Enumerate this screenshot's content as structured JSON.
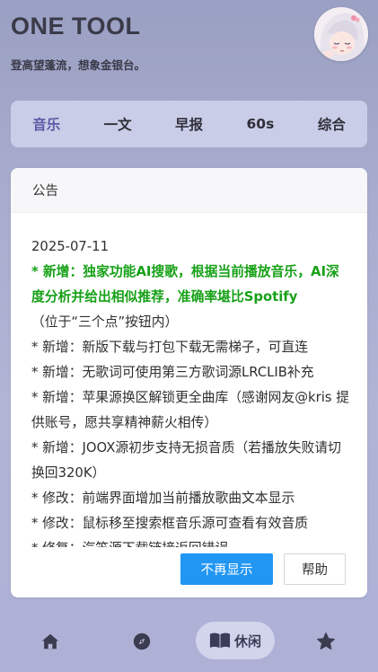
{
  "header": {
    "title": "ONE TOOL",
    "subtitle": "登高望蓬流，想象金银台。"
  },
  "tabs": [
    {
      "label": "音乐",
      "active": true
    },
    {
      "label": "一文",
      "active": false
    },
    {
      "label": "早报",
      "active": false
    },
    {
      "label": "60s",
      "active": false
    },
    {
      "label": "综合",
      "active": false
    }
  ],
  "announcement": {
    "title": "公告",
    "date": "2025-07-11",
    "highlight": "* 新增：独家功能AI搜歌，根据当前播放音乐，AI深度分析并给出相似推荐，准确率堪比Spotify",
    "highlight_note": "（位于“三个点”按钮内）",
    "items": [
      "* 新增：新版下载与打包下载无需梯子，可直连",
      "* 新增：无歌词可使用第三方歌词源LRCLIB补充",
      "* 新增：苹果源换区解锁更全曲库（感谢网友@kris 提供账号，愿共享精神薪火相传）",
      "* 新增：JOOX源初步支持无损音质（若播放失败请切换回320K）",
      "* 修改：前端界面增加当前播放歌曲文本显示",
      "* 修改：鼠标移至搜索框音乐源可查看有效音质",
      "* 修复：汽笛源下载链接返回错误"
    ],
    "primary_button": "不再显示",
    "secondary_button": "帮助"
  },
  "bottom_nav": {
    "items": [
      {
        "icon": "home-icon"
      },
      {
        "icon": "compass-icon"
      },
      {
        "icon": "book-icon",
        "label": "休闲",
        "active": true
      },
      {
        "icon": "star-icon"
      }
    ]
  },
  "colors": {
    "accent": "#2196f3",
    "highlight_text": "#17a117",
    "active_tab": "#5a5aa6"
  }
}
